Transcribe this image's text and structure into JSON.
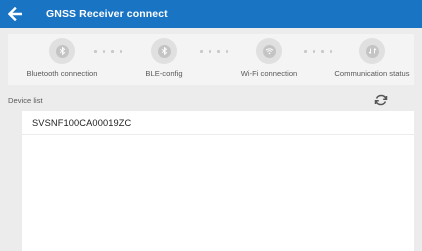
{
  "header": {
    "title": "GNSS Receiver connect",
    "background": "#1a74c4",
    "back_icon": "arrow-left-icon"
  },
  "steps": [
    {
      "label": "Bluetooth connection",
      "icon": "bluetooth-icon"
    },
    {
      "label": "BLE-config",
      "icon": "bluetooth-icon"
    },
    {
      "label": "Wi-Fi connection",
      "icon": "wifi-icon"
    },
    {
      "label": "Communication status",
      "icon": "communication-icon"
    }
  ],
  "device_list": {
    "title": "Device list",
    "refresh_icon": "refresh-icon",
    "devices": [
      "SVSNF100CA00019ZC"
    ]
  }
}
